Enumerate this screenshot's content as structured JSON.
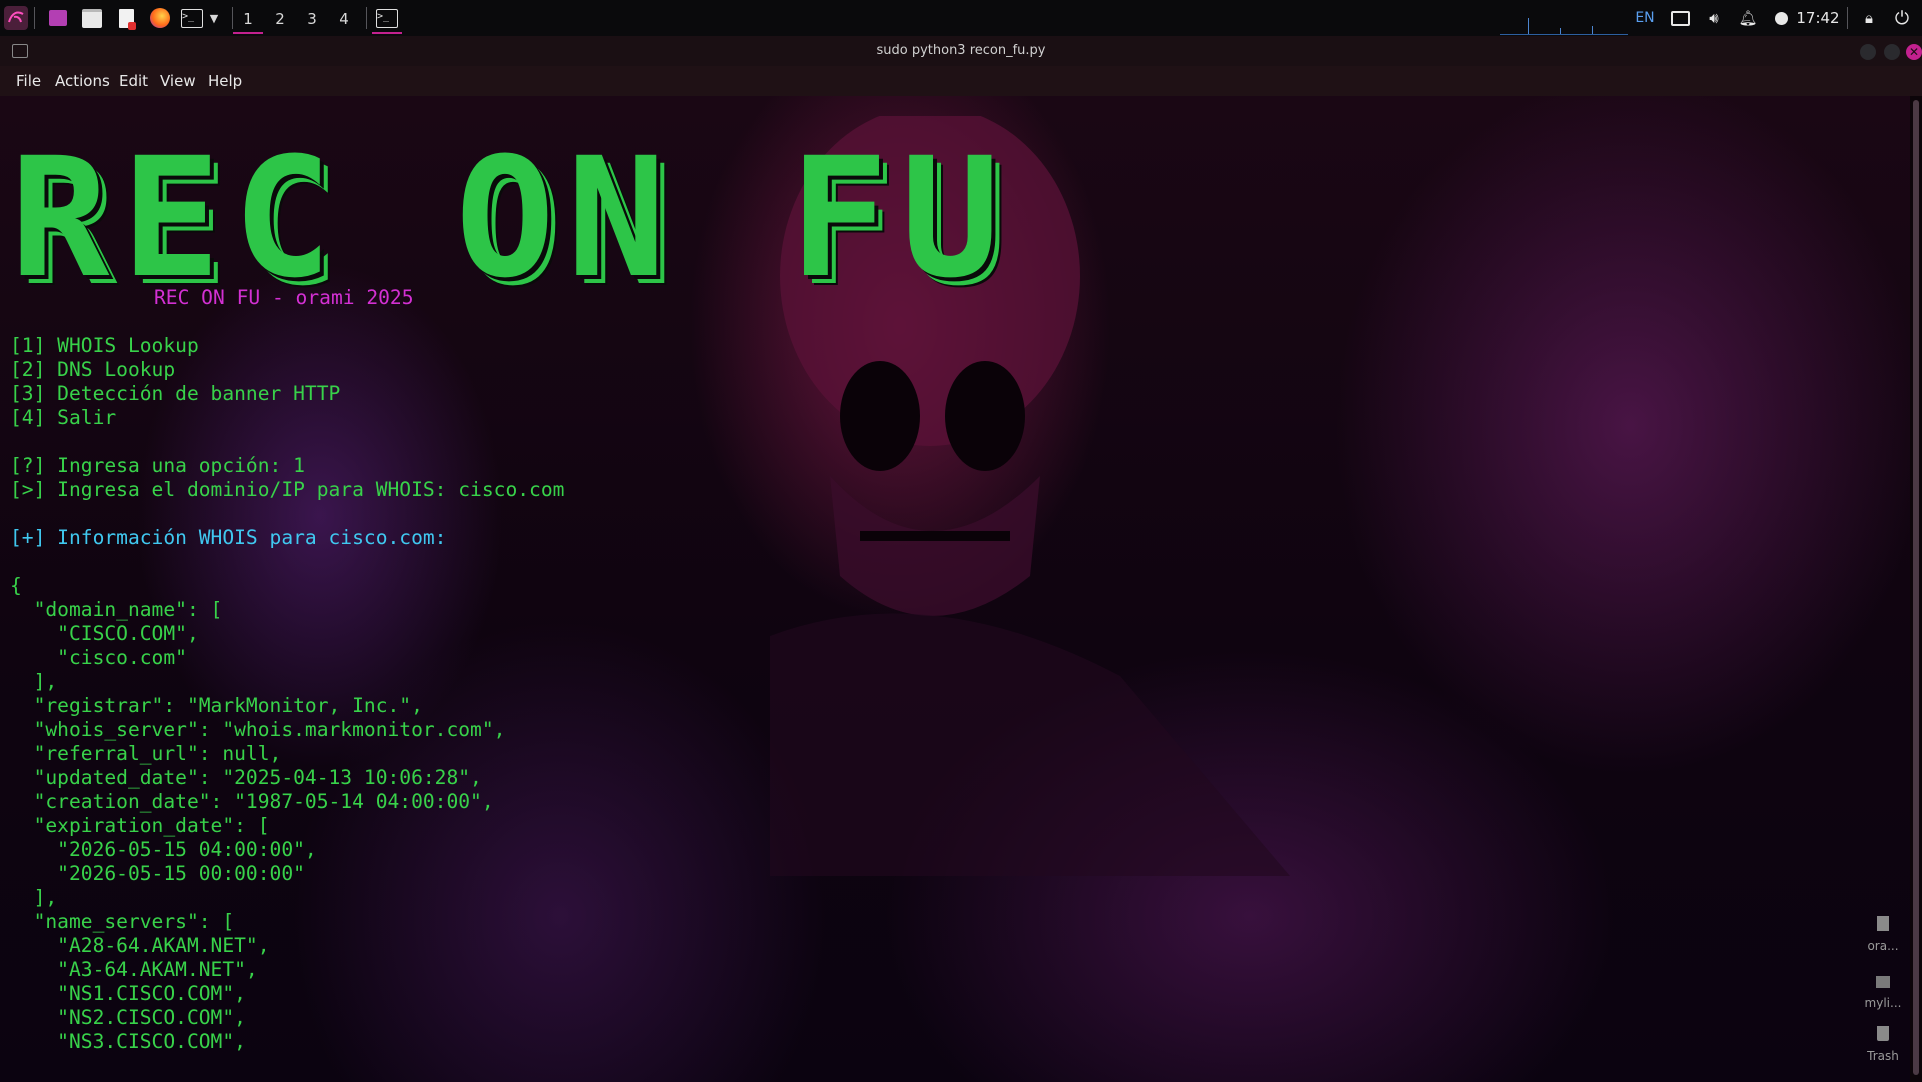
{
  "taskbar": {
    "workspaces": [
      "1",
      "2",
      "3",
      "4"
    ],
    "active_workspace": "1",
    "lang": "EN",
    "clock": "17:42",
    "icons": [
      "kali-menu-icon",
      "window-icon",
      "files-icon",
      "text-editor-icon",
      "firefox-icon",
      "terminal-icon",
      "chevron-down-icon"
    ]
  },
  "window": {
    "title": "sudo python3 recon_fu.py",
    "menu": [
      "File",
      "Actions",
      "Edit",
      "View",
      "Help"
    ]
  },
  "terminal": {
    "banner": "REC ON FU",
    "subtitle": "REC ON FU - orami 2025",
    "menu_lines": [
      "[1] WHOIS Lookup",
      "[2] DNS Lookup",
      "[3] Detección de banner HTTP",
      "[4] Salir"
    ],
    "prompt_option": "[?] Ingresa una opción: 1",
    "prompt_domain": "[>] Ingresa el dominio/IP para WHOIS: cisco.com",
    "info_line": "[+] Información WHOIS para cisco.com:",
    "json_lines": [
      "{",
      "  \"domain_name\": [",
      "    \"CISCO.COM\",",
      "    \"cisco.com\"",
      "  ],",
      "  \"registrar\": \"MarkMonitor, Inc.\",",
      "  \"whois_server\": \"whois.markmonitor.com\",",
      "  \"referral_url\": null,",
      "  \"updated_date\": \"2025-04-13 10:06:28\",",
      "  \"creation_date\": \"1987-05-14 04:00:00\",",
      "  \"expiration_date\": [",
      "    \"2026-05-15 04:00:00\",",
      "    \"2026-05-15 00:00:00\"",
      "  ],",
      "  \"name_servers\": [",
      "    \"A28-64.AKAM.NET\",",
      "    \"A3-64.AKAM.NET\",",
      "    \"NS1.CISCO.COM\",",
      "    \"NS2.CISCO.COM\",",
      "    \"NS3.CISCO.COM\","
    ]
  },
  "desktop": {
    "icons": [
      "ora...",
      "myli...",
      "Trash"
    ]
  },
  "colors": {
    "accent": "#c3218f",
    "green": "#38d24a",
    "magenta": "#d330d3",
    "cyan": "#40c8f0"
  }
}
